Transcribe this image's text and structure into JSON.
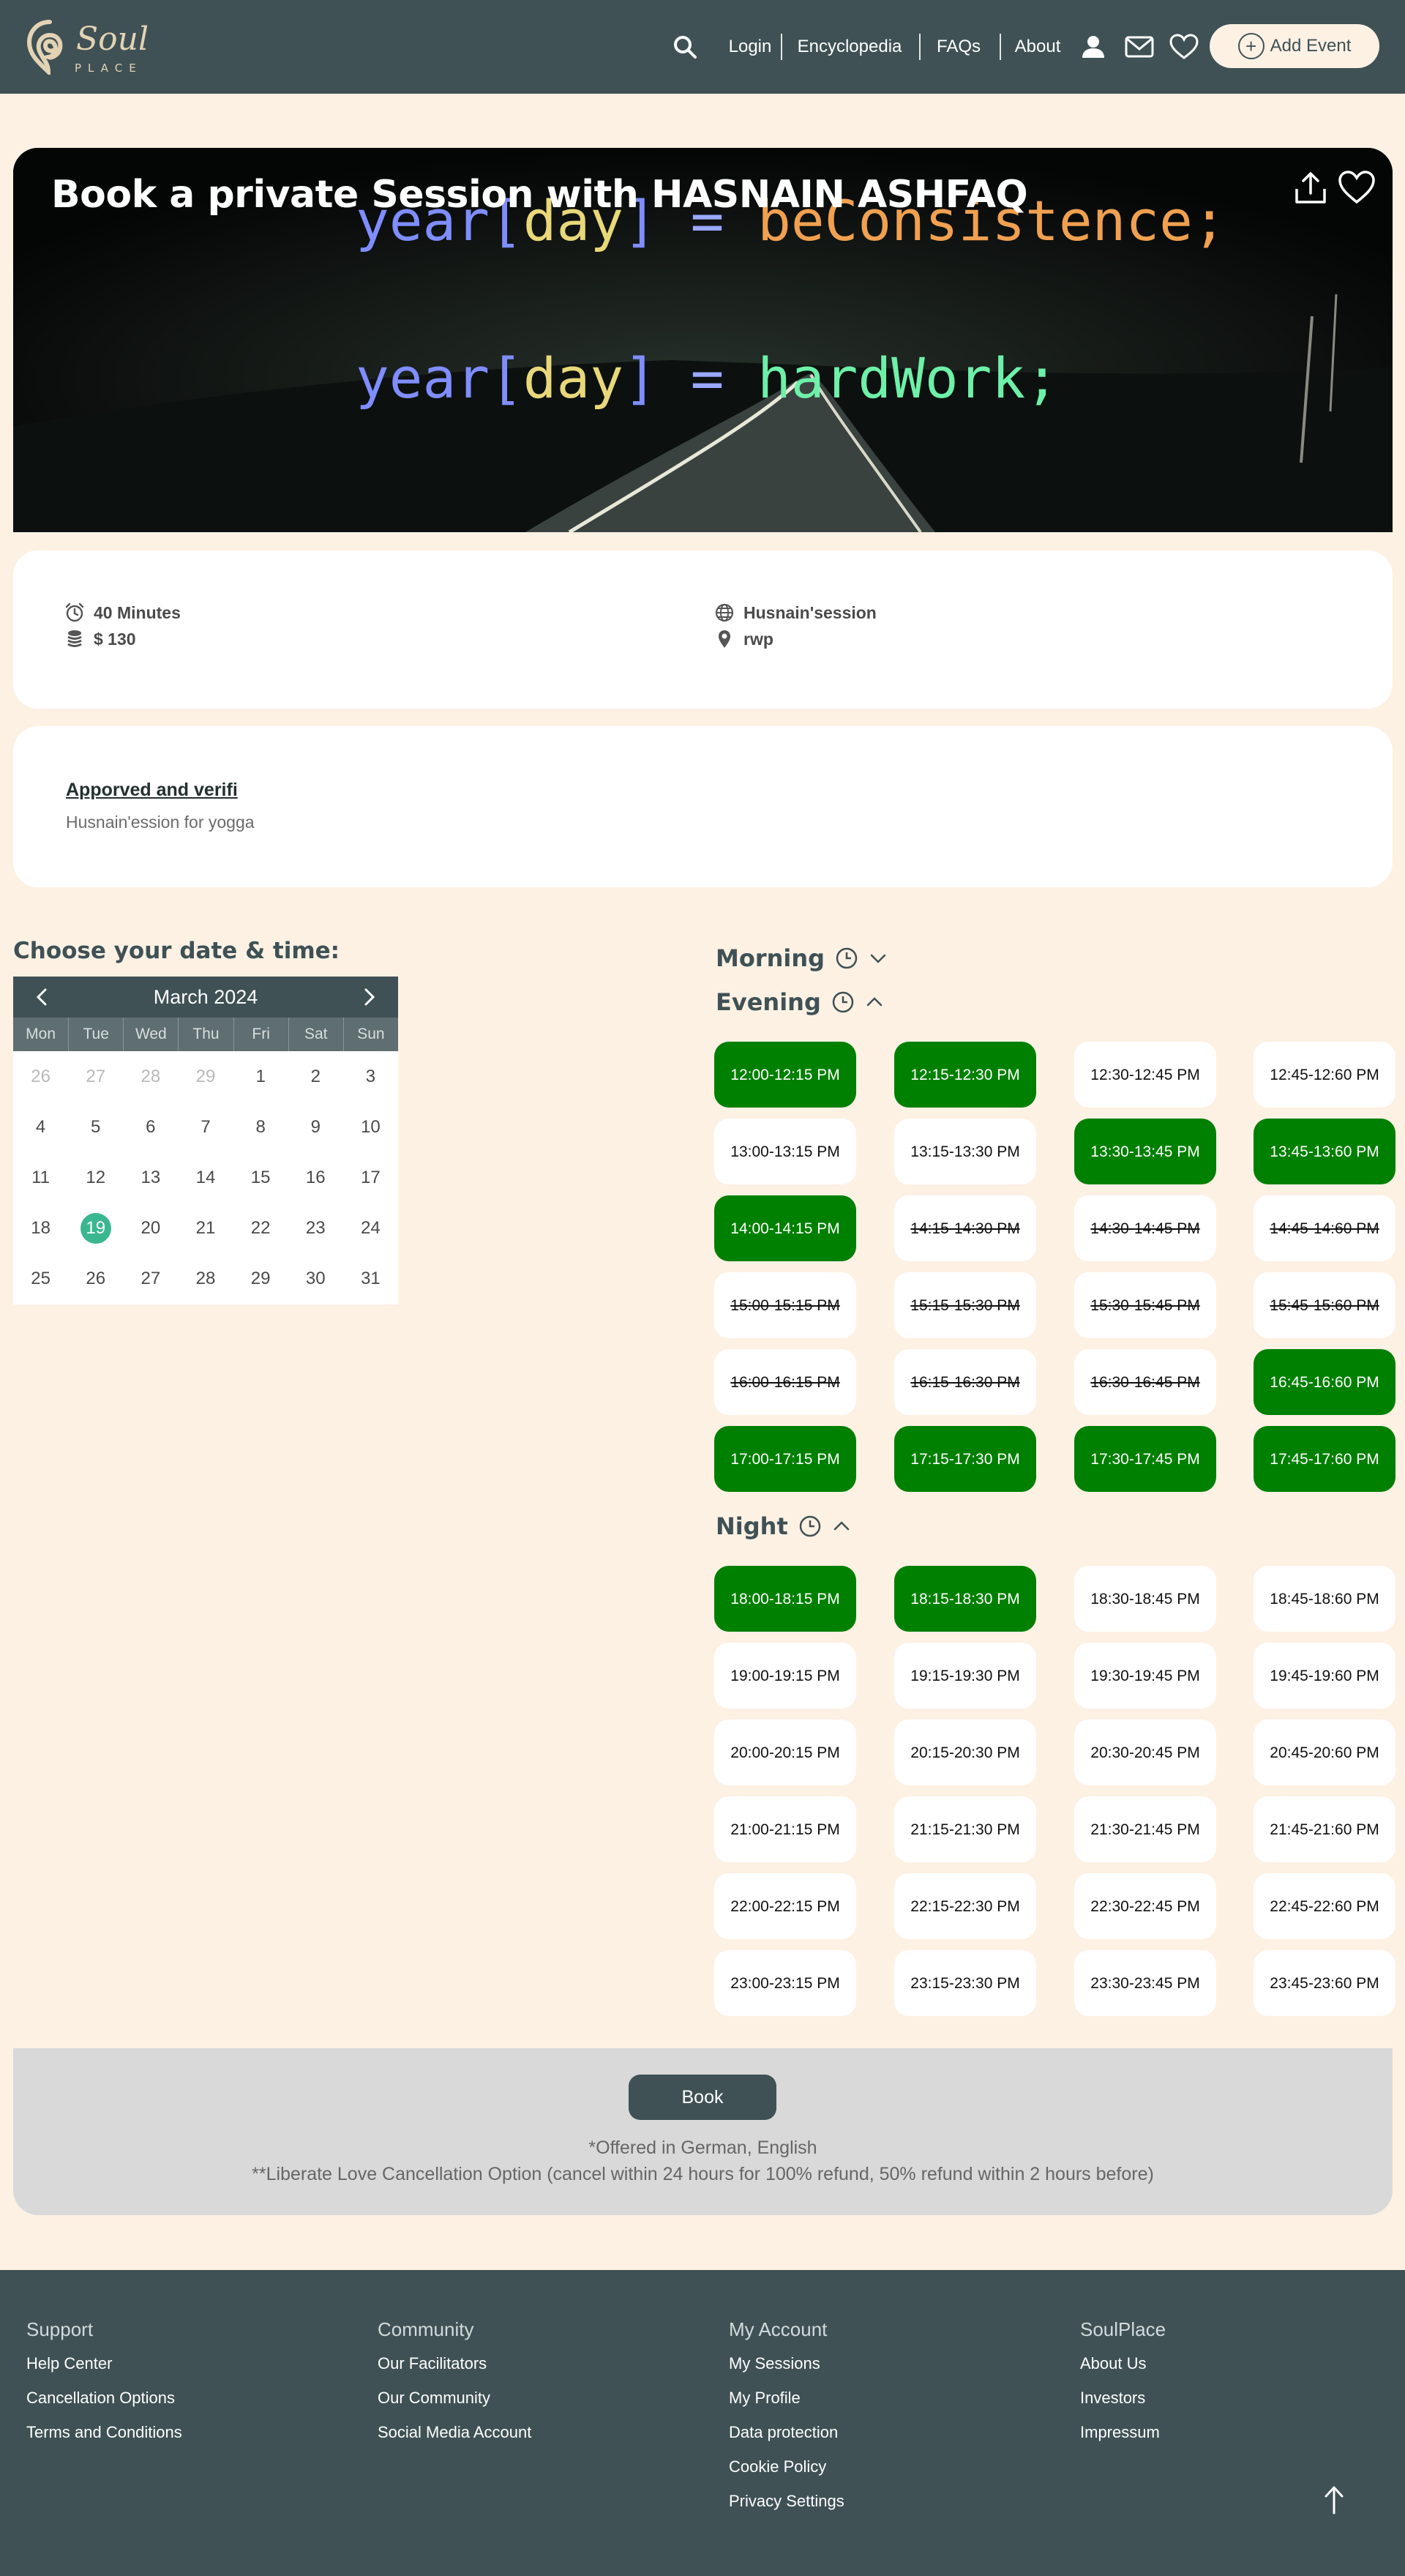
{
  "header": {
    "logo_word": "Soul",
    "logo_sub": "PLACE",
    "nav": [
      "Login",
      "Encyclopedia",
      "FAQs",
      "About"
    ],
    "add_event": "Add Event"
  },
  "hero": {
    "title": "Book a private Session with HASNAIN ASHFAQ",
    "code_line_1": {
      "a": "year[",
      "b": "day",
      "c": "]",
      "d": " = ",
      "e": "beConsistence;"
    },
    "code_line_2": {
      "a": "year[",
      "b": "day",
      "c": "]",
      "d": " = ",
      "e": "hardWork;"
    }
  },
  "info": {
    "duration": "40 Minutes",
    "price": "$ 130",
    "session_name": "Husnain'session",
    "location": "rwp"
  },
  "description": {
    "title": "Apporved and verifi",
    "text": "Husnain'ession for yogga"
  },
  "calendar": {
    "heading": "Choose your date & time:",
    "month": "March 2024",
    "weekdays": [
      "Mon",
      "Tue",
      "Wed",
      "Thu",
      "Fri",
      "Sat",
      "Sun"
    ],
    "days": [
      {
        "d": "26",
        "muted": true
      },
      {
        "d": "27",
        "muted": true
      },
      {
        "d": "28",
        "muted": true
      },
      {
        "d": "29",
        "muted": true
      },
      {
        "d": "1"
      },
      {
        "d": "2"
      },
      {
        "d": "3"
      },
      {
        "d": "4"
      },
      {
        "d": "5"
      },
      {
        "d": "6"
      },
      {
        "d": "7"
      },
      {
        "d": "8"
      },
      {
        "d": "9"
      },
      {
        "d": "10"
      },
      {
        "d": "11"
      },
      {
        "d": "12"
      },
      {
        "d": "13"
      },
      {
        "d": "14"
      },
      {
        "d": "15"
      },
      {
        "d": "16"
      },
      {
        "d": "17"
      },
      {
        "d": "18"
      },
      {
        "d": "19",
        "selected": true
      },
      {
        "d": "20"
      },
      {
        "d": "21"
      },
      {
        "d": "22"
      },
      {
        "d": "23"
      },
      {
        "d": "24"
      },
      {
        "d": "25"
      },
      {
        "d": "26"
      },
      {
        "d": "27"
      },
      {
        "d": "28"
      },
      {
        "d": "29"
      },
      {
        "d": "30"
      },
      {
        "d": "31"
      }
    ]
  },
  "slots": {
    "morning_label": "Morning",
    "evening_label": "Evening",
    "night_label": "Night",
    "evening": [
      {
        "t": "12:00-12:15 PM",
        "s": "avail"
      },
      {
        "t": "12:15-12:30 PM",
        "s": "avail"
      },
      {
        "t": "12:30-12:45 PM",
        "s": "open"
      },
      {
        "t": "12:45-12:60 PM",
        "s": "open"
      },
      {
        "t": "13:00-13:15 PM",
        "s": "open"
      },
      {
        "t": "13:15-13:30 PM",
        "s": "open"
      },
      {
        "t": "13:30-13:45 PM",
        "s": "avail"
      },
      {
        "t": "13:45-13:60 PM",
        "s": "avail"
      },
      {
        "t": "14:00-14:15 PM",
        "s": "avail"
      },
      {
        "t": "14:15-14:30 PM",
        "s": "off"
      },
      {
        "t": "14:30-14:45 PM",
        "s": "off"
      },
      {
        "t": "14:45-14:60 PM",
        "s": "off"
      },
      {
        "t": "15:00-15:15 PM",
        "s": "off"
      },
      {
        "t": "15:15-15:30 PM",
        "s": "off"
      },
      {
        "t": "15:30-15:45 PM",
        "s": "off"
      },
      {
        "t": "15:45-15:60 PM",
        "s": "off"
      },
      {
        "t": "16:00-16:15 PM",
        "s": "off"
      },
      {
        "t": "16:15-16:30 PM",
        "s": "off"
      },
      {
        "t": "16:30-16:45 PM",
        "s": "off"
      },
      {
        "t": "16:45-16:60 PM",
        "s": "avail"
      },
      {
        "t": "17:00-17:15 PM",
        "s": "avail"
      },
      {
        "t": "17:15-17:30 PM",
        "s": "avail"
      },
      {
        "t": "17:30-17:45 PM",
        "s": "avail"
      },
      {
        "t": "17:45-17:60 PM",
        "s": "avail"
      }
    ],
    "night": [
      {
        "t": "18:00-18:15 PM",
        "s": "avail"
      },
      {
        "t": "18:15-18:30 PM",
        "s": "avail"
      },
      {
        "t": "18:30-18:45 PM",
        "s": "open"
      },
      {
        "t": "18:45-18:60 PM",
        "s": "open"
      },
      {
        "t": "19:00-19:15 PM",
        "s": "open"
      },
      {
        "t": "19:15-19:30 PM",
        "s": "open"
      },
      {
        "t": "19:30-19:45 PM",
        "s": "open"
      },
      {
        "t": "19:45-19:60 PM",
        "s": "open"
      },
      {
        "t": "20:00-20:15 PM",
        "s": "open"
      },
      {
        "t": "20:15-20:30 PM",
        "s": "open"
      },
      {
        "t": "20:30-20:45 PM",
        "s": "open"
      },
      {
        "t": "20:45-20:60 PM",
        "s": "open"
      },
      {
        "t": "21:00-21:15 PM",
        "s": "open"
      },
      {
        "t": "21:15-21:30 PM",
        "s": "open"
      },
      {
        "t": "21:30-21:45 PM",
        "s": "open"
      },
      {
        "t": "21:45-21:60 PM",
        "s": "open"
      },
      {
        "t": "22:00-22:15 PM",
        "s": "open"
      },
      {
        "t": "22:15-22:30 PM",
        "s": "open"
      },
      {
        "t": "22:30-22:45 PM",
        "s": "open"
      },
      {
        "t": "22:45-22:60 PM",
        "s": "open"
      },
      {
        "t": "23:00-23:15 PM",
        "s": "open"
      },
      {
        "t": "23:15-23:30 PM",
        "s": "open"
      },
      {
        "t": "23:30-23:45 PM",
        "s": "open"
      },
      {
        "t": "23:45-23:60 PM",
        "s": "open"
      }
    ]
  },
  "booking": {
    "button": "Book",
    "languages": "*Offered in German, English",
    "cancellation": "**Liberate Love Cancellation Option (cancel within 24 hours for 100% refund, 50% refund within 2 hours before)"
  },
  "footer": {
    "columns": [
      {
        "title": "Support",
        "links": [
          "Help Center",
          "Cancellation Options",
          "Terms and Conditions"
        ]
      },
      {
        "title": "Community",
        "links": [
          "Our Facilitators",
          "Our Community",
          "Social Media Account"
        ]
      },
      {
        "title": "My Account",
        "links": [
          "My Sessions",
          "My Profile",
          "Data protection",
          "Cookie Policy",
          "Privacy Settings"
        ]
      },
      {
        "title": "SoulPlace",
        "links": [
          "About Us",
          "Investors",
          "Impressum"
        ]
      }
    ]
  },
  "colors": {
    "primary": "#3f5155",
    "background": "#fdf1e4",
    "slot_available": "#008000",
    "selected_day": "#3bb78f"
  }
}
